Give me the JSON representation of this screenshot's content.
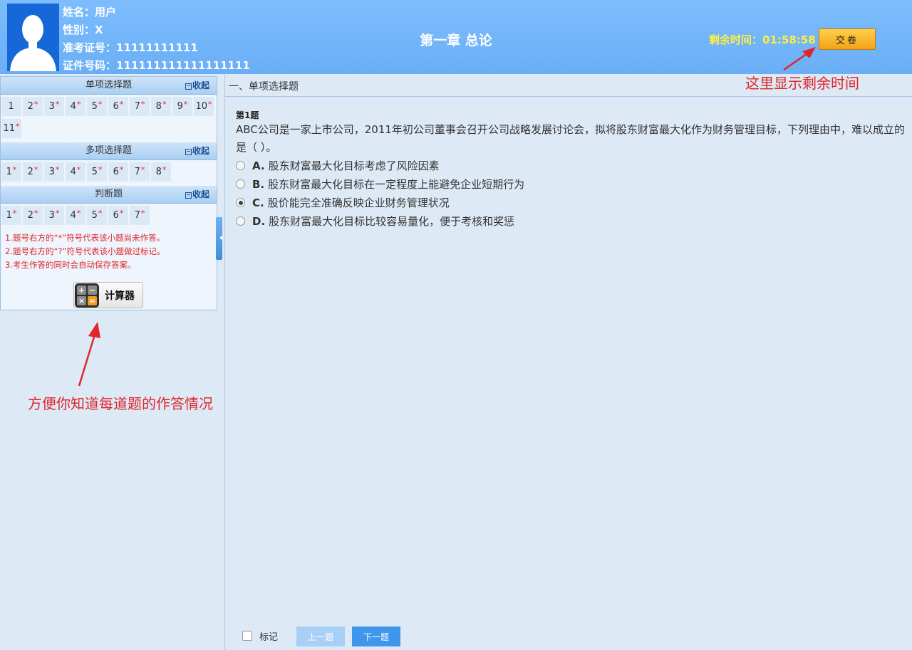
{
  "candidate": {
    "name_label": "姓名：用户",
    "gender_label": "性别：X",
    "exam_no_label": "准考证号：11111111111",
    "id_no_label": "证件号码：111111111111111111"
  },
  "header": {
    "chapter_title": "第一章 总论",
    "timer_label": "剩余时间：",
    "timer_value": "01:58:58",
    "submit_label": "交卷"
  },
  "sidebar": {
    "collapse_label": "收起",
    "sections": [
      {
        "title": "单项选择题",
        "items": [
          {
            "n": "1",
            "star": ""
          },
          {
            "n": "2",
            "star": "*"
          },
          {
            "n": "3",
            "star": "*"
          },
          {
            "n": "4",
            "star": "*"
          },
          {
            "n": "5",
            "star": "*"
          },
          {
            "n": "6",
            "star": "*"
          },
          {
            "n": "7",
            "star": "*"
          },
          {
            "n": "8",
            "star": "*"
          },
          {
            "n": "9",
            "star": "*"
          },
          {
            "n": "10",
            "star": "*"
          },
          {
            "n": "11",
            "star": "*"
          }
        ]
      },
      {
        "title": "多项选择题",
        "items": [
          {
            "n": "1",
            "star": "*"
          },
          {
            "n": "2",
            "star": "*"
          },
          {
            "n": "3",
            "star": "*"
          },
          {
            "n": "4",
            "star": "*"
          },
          {
            "n": "5",
            "star": "*"
          },
          {
            "n": "6",
            "star": "*"
          },
          {
            "n": "7",
            "star": "*"
          },
          {
            "n": "8",
            "star": "*"
          }
        ]
      },
      {
        "title": "判断题",
        "items": [
          {
            "n": "1",
            "star": "*"
          },
          {
            "n": "2",
            "star": "*"
          },
          {
            "n": "3",
            "star": "*"
          },
          {
            "n": "4",
            "star": "*"
          },
          {
            "n": "5",
            "star": "*"
          },
          {
            "n": "6",
            "star": "*"
          },
          {
            "n": "7",
            "star": "*"
          }
        ]
      }
    ],
    "notes": [
      "1.题号右方的“*”符号代表该小题尚未作答。",
      "2.题号右方的“?”符号代表该小题做过标记。",
      "3.考生作答的同时会自动保存答案。"
    ],
    "calculator_label": "计算器"
  },
  "annotations": {
    "timer_note": "这里显示剩余时间",
    "sidebar_note": "方便你知道每道题的作答情况"
  },
  "main": {
    "section_title": "一、单项选择题",
    "question_no": "第1题",
    "question_text": "ABC公司是一家上市公司，2011年初公司董事会召开公司战略发展讨论会，拟将股东财富最大化作为财务管理目标，下列理由中，难以成立的是（ ）。",
    "options": [
      {
        "letter": "A.",
        "text": "股东财富最大化目标考虑了风险因素",
        "checked": false
      },
      {
        "letter": "B.",
        "text": "股东财富最大化目标在一定程度上能避免企业短期行为",
        "checked": false
      },
      {
        "letter": "C.",
        "text": "股价能完全准确反映企业财务管理状况",
        "checked": true
      },
      {
        "letter": "D.",
        "text": "股东财富最大化目标比较容易量化，便于考核和奖惩",
        "checked": false
      }
    ],
    "mark_label": "标记",
    "prev_label": "上一题",
    "next_label": "下一题"
  },
  "colors": {
    "header_bg": "#7dbdfd",
    "timer": "#ffef3c",
    "star": "#e0262b",
    "primary_btn": "#3e97ea",
    "annotation": "#e0262b"
  }
}
